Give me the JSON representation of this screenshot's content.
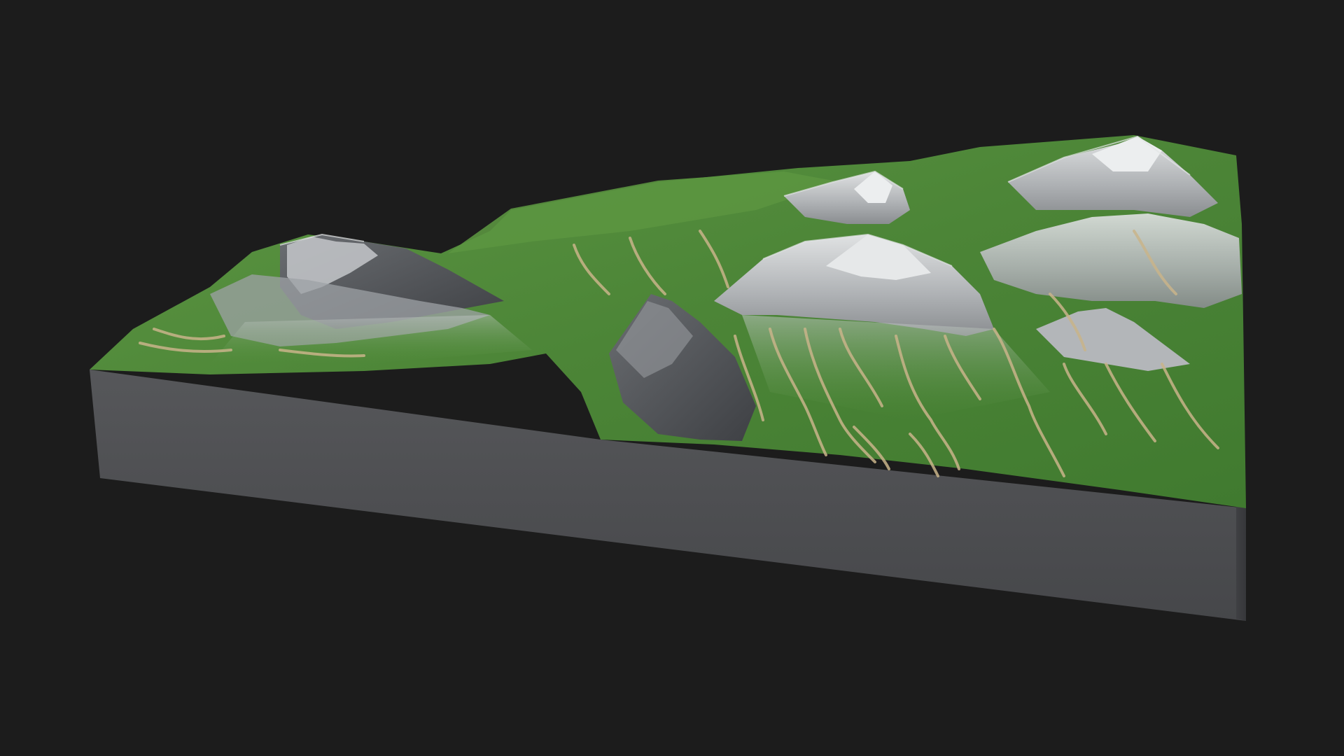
{
  "scene": {
    "subject": "terrain-block-render",
    "colors": {
      "background": "#1c1c1c",
      "block_front": "#4a4b4d",
      "block_side": "#3b3c3e",
      "grass": "#4f8a3a",
      "grass_dark": "#3c6e2c",
      "grass_light": "#78aa55",
      "rock": "#a9acaf",
      "rock_dark": "#55585c",
      "rock_light": "#d6d8da",
      "channel": "#c9b48a"
    }
  }
}
